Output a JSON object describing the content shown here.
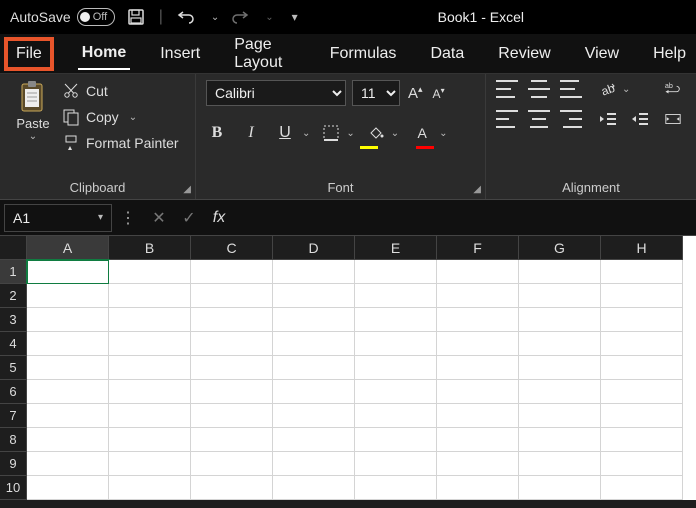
{
  "titlebar": {
    "autosave_label": "AutoSave",
    "autosave_off": "Off",
    "title": "Book1  -  Excel"
  },
  "tabs": {
    "file": "File",
    "home": "Home",
    "insert": "Insert",
    "page_layout": "Page Layout",
    "formulas": "Formulas",
    "data": "Data",
    "review": "Review",
    "view": "View",
    "help": "Help"
  },
  "ribbon": {
    "clipboard": {
      "paste": "Paste",
      "cut": "Cut",
      "copy": "Copy",
      "format_painter": "Format Painter",
      "group_label": "Clipboard"
    },
    "font": {
      "name": "Calibri",
      "size": "11",
      "group_label": "Font",
      "bold": "B",
      "italic": "I",
      "underline": "U",
      "fill_color": "#ffff00",
      "font_color": "#ff0000"
    },
    "alignment": {
      "group_label": "Alignment",
      "wrap_label": "ab"
    }
  },
  "fxbar": {
    "namebox": "A1",
    "fx": "fx",
    "formula": ""
  },
  "grid": {
    "columns": [
      "A",
      "B",
      "C",
      "D",
      "E",
      "F",
      "G",
      "H"
    ],
    "rows": [
      "1",
      "2",
      "3",
      "4",
      "5",
      "6",
      "7",
      "8",
      "9",
      "10"
    ],
    "selected_col": 0,
    "selected_row": 0
  }
}
